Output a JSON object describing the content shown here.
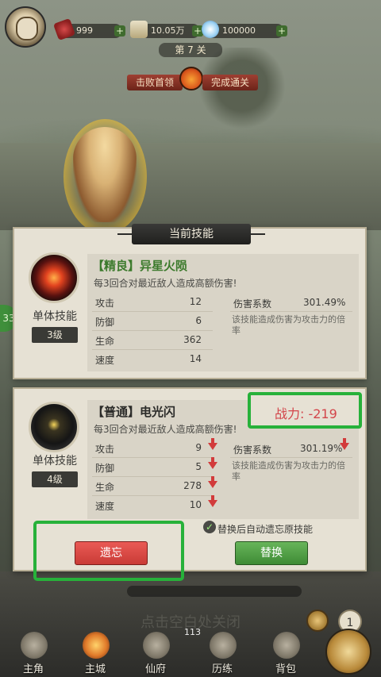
{
  "top_bar": {
    "resources": [
      {
        "icon": "firecracker-icon",
        "value": "999"
      },
      {
        "icon": "scroll-icon",
        "value": "10.05万"
      },
      {
        "icon": "crystal-icon",
        "value": "100000"
      }
    ],
    "plus_label": "+",
    "stage": "第 7 关",
    "goal_boss": "击败首领",
    "goal_clear": "完成通关"
  },
  "side_badge": "33",
  "current_skill": {
    "panel_title": "当前技能",
    "name": "【精良】异星火陨",
    "description": "每3回合对最近敌人造成高额伤害!",
    "type": "单体技能",
    "level": "3级",
    "stats": [
      {
        "label": "攻击",
        "value": "12"
      },
      {
        "label": "防御",
        "value": "6"
      },
      {
        "label": "生命",
        "value": "362"
      },
      {
        "label": "速度",
        "value": "14"
      }
    ],
    "coef_label": "伤害系数",
    "coef_value": "301.49%",
    "coef_desc": "该技能造成伤害为攻击力的倍率"
  },
  "new_skill": {
    "name": "【普通】电光闪",
    "description": "每3回合对最近敌人造成高额伤害!",
    "type": "单体技能",
    "level": "4级",
    "power": "战力: -219",
    "stats": [
      {
        "label": "攻击",
        "value": "9",
        "trend": "down"
      },
      {
        "label": "防御",
        "value": "5",
        "trend": "down"
      },
      {
        "label": "生命",
        "value": "278",
        "trend": "down"
      },
      {
        "label": "速度",
        "value": "10",
        "trend": "down"
      }
    ],
    "coef_label": "伤害系数",
    "coef_value": "301.19%",
    "coef_trend": "down",
    "coef_desc": "该技能造成伤害为攻击力的倍率",
    "auto_forget_label": "替换后自动遗忘原技能",
    "forget_button": "遗忘",
    "replace_button": "替换"
  },
  "close_hint": "点击空白处关闭",
  "counter": "113",
  "badge_count": "1",
  "nav": [
    {
      "label": "主角",
      "icon": "hero-icon"
    },
    {
      "label": "主城",
      "icon": "city-icon"
    },
    {
      "label": "仙府",
      "icon": "mansion-icon"
    },
    {
      "label": "历练",
      "icon": "training-icon"
    },
    {
      "label": "背包",
      "icon": "bag-icon"
    }
  ],
  "colors": {
    "highlight": "#27b13a",
    "power": "#d3454a",
    "forget": "#d84a45",
    "replace": "#4f9f44",
    "quality_fine": "#3c7a2c"
  }
}
